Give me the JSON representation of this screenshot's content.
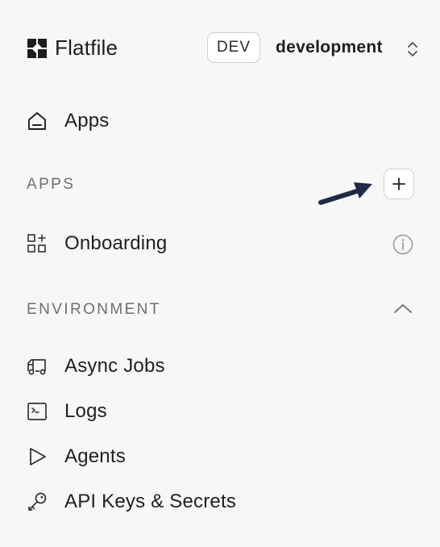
{
  "header": {
    "brand": "Flatfile",
    "env_badge": "DEV",
    "env_name": "development"
  },
  "nav": {
    "apps_label": "Apps"
  },
  "apps_section": {
    "title": "APPS",
    "items": [
      {
        "label": "Onboarding",
        "icon": "grid-plus-icon"
      }
    ]
  },
  "environment_section": {
    "title": "ENVIRONMENT",
    "items": [
      {
        "label": "Async Jobs",
        "icon": "truck-icon"
      },
      {
        "label": "Logs",
        "icon": "terminal-icon"
      },
      {
        "label": "Agents",
        "icon": "play-icon"
      },
      {
        "label": "API Keys & Secrets",
        "icon": "key-icon"
      }
    ]
  },
  "colors": {
    "background": "#f7f7f7",
    "arrow": "#1f2a44",
    "section_title": "#6f6f6f"
  }
}
